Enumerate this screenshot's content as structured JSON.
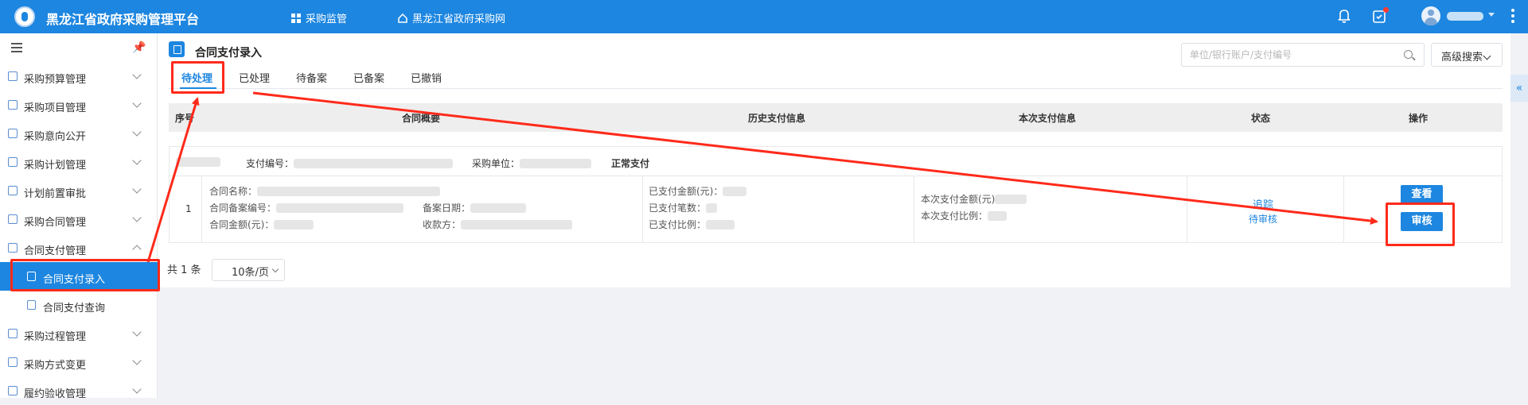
{
  "app": {
    "title": "黑龙江省政府采购管理平台"
  },
  "topnav": {
    "monitor": "采购监管",
    "site": "黑龙江省政府采购网"
  },
  "icons": {
    "menu": "hamburger-icon",
    "pin": "pin-icon",
    "bell": "bell-icon",
    "task": "task-icon",
    "more": "more-vertical-icon",
    "search": "search-icon"
  },
  "sidebar": {
    "items": [
      {
        "label": "采购预算管理"
      },
      {
        "label": "采购项目管理"
      },
      {
        "label": "采购意向公开"
      },
      {
        "label": "采购计划管理"
      },
      {
        "label": "计划前置审批"
      },
      {
        "label": "采购合同管理"
      },
      {
        "label": "合同支付管理"
      },
      {
        "label": "采购过程管理"
      },
      {
        "label": "采购方式变更"
      },
      {
        "label": "履约验收管理"
      }
    ],
    "sub_items": [
      {
        "label": "合同支付录入"
      },
      {
        "label": "合同支付查询"
      }
    ]
  },
  "page": {
    "title": "合同支付录入",
    "search_placeholder": "单位/银行账户/支付编号",
    "advanced_search": "高级搜索",
    "tabs": [
      "待处理",
      "已处理",
      "待备案",
      "已备案",
      "已撤销"
    ],
    "active_tab": "待处理"
  },
  "table": {
    "headers": [
      "序号",
      "合同概要",
      "历史支付信息",
      "本次支付信息",
      "状态",
      "操作"
    ],
    "group": {
      "payment_no_label": "支付编号：",
      "unit_label": "采购单位：",
      "pay_type": "正常支付"
    },
    "row": {
      "seq": "1",
      "contract_name_label": "合同名称：",
      "contract_record_no_label": "合同备案编号：",
      "record_date_label": "备案日期：",
      "contract_amount_label": "合同金额(元)：",
      "payee_label": "收款方：",
      "paid_amount_label": "已支付金额(元)：",
      "paid_count_label": "已支付笔数：",
      "paid_ratio_label": "已支付比例：",
      "current_amount_label": "本次支付金额(元)",
      "current_ratio_label": "本次支付比例：",
      "track": "追踪",
      "status": "待审核",
      "view": "查看",
      "audit": "审核"
    }
  },
  "pagination": {
    "total": "共 1 条",
    "page_size": "10条/页"
  },
  "colors": {
    "primary": "#1d86e0",
    "annotation": "#ff2a1a"
  }
}
